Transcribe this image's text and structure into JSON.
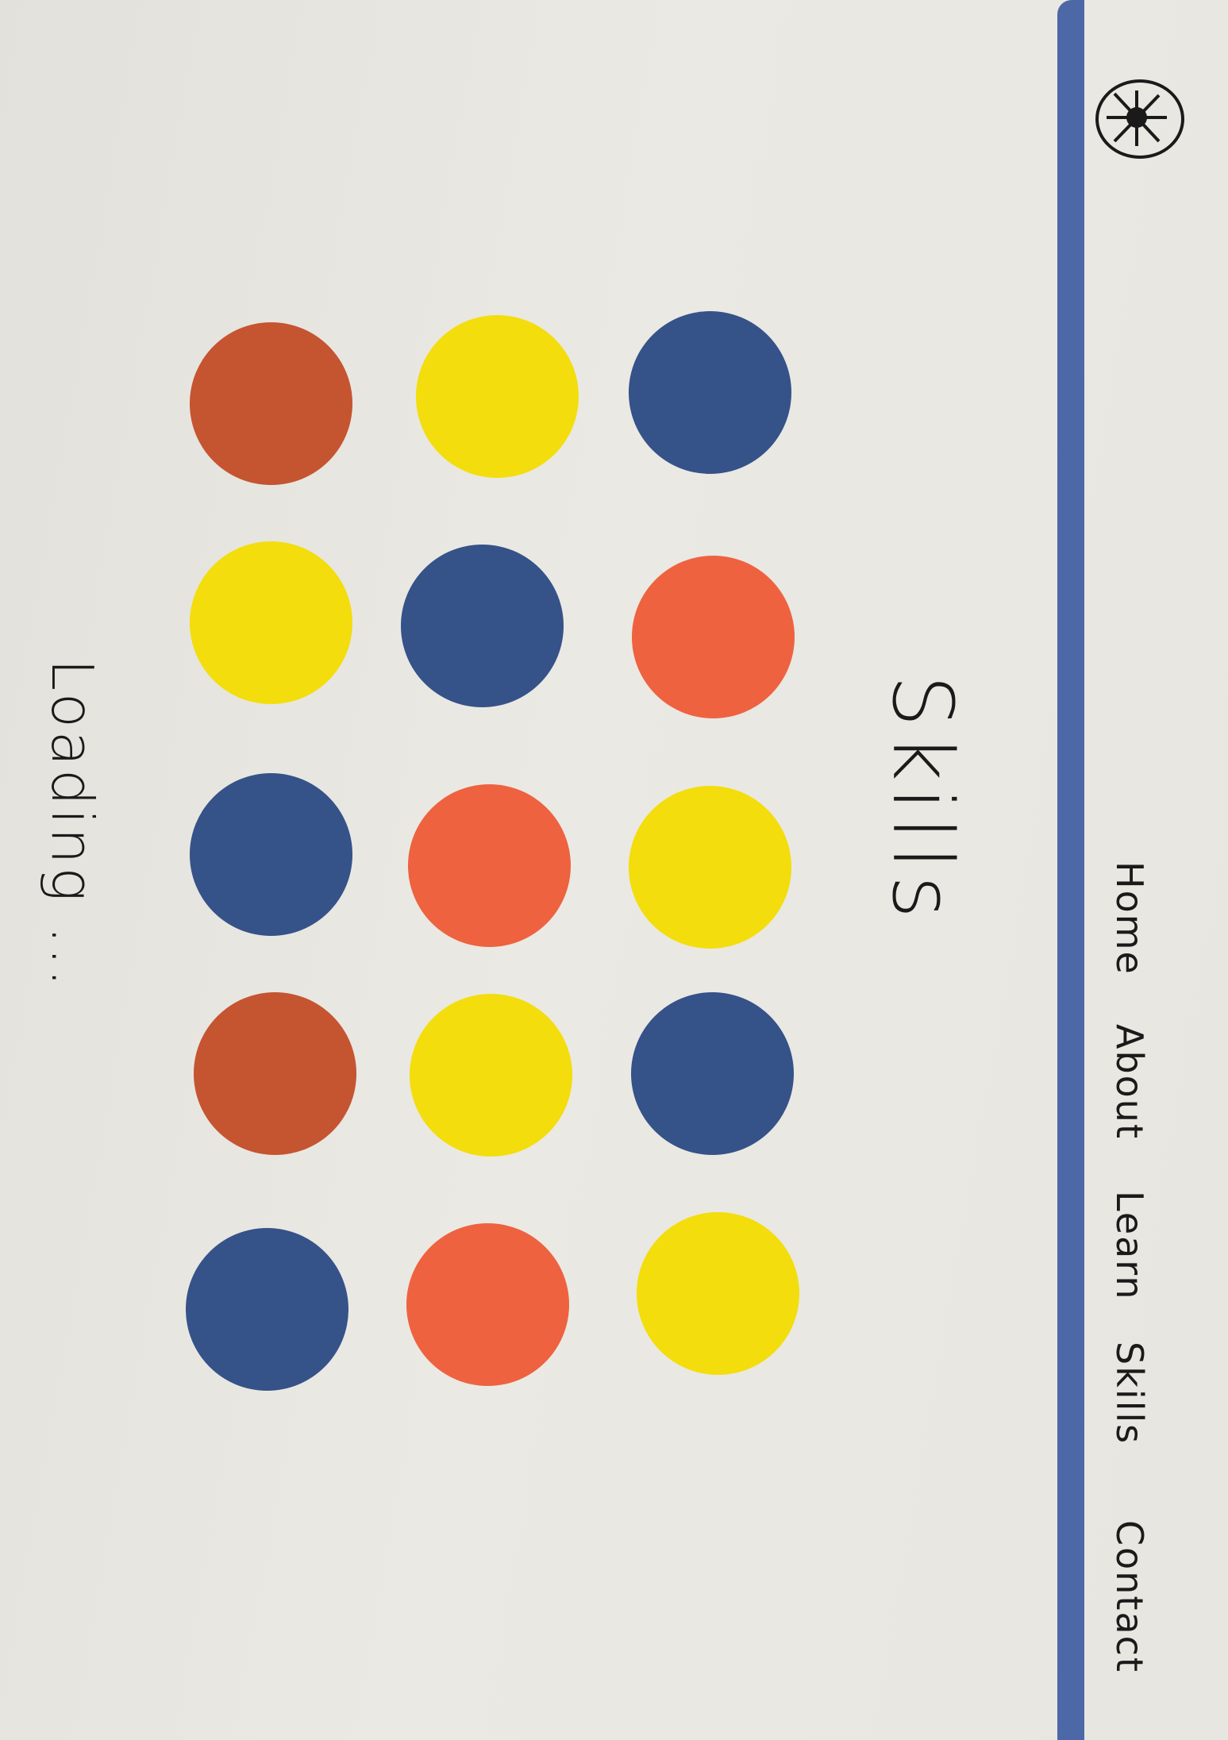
{
  "nav": {
    "items": [
      {
        "label": "Home"
      },
      {
        "label": "About"
      },
      {
        "label": "Learn"
      },
      {
        "label": "Skills"
      },
      {
        "label": "Contact"
      }
    ]
  },
  "page_title": "Skills",
  "loading_text": "Loading ...",
  "colors": {
    "rule": "#4d68a6",
    "navy": "#355289",
    "yellow": "#f3dd0c",
    "orange": "#ee6240",
    "rust": "#c55431"
  },
  "skill_dots": [
    {
      "color": "rust"
    },
    {
      "color": "yellow"
    },
    {
      "color": "navy"
    },
    {
      "color": "yellow"
    },
    {
      "color": "navy"
    },
    {
      "color": "orange"
    },
    {
      "color": "navy"
    },
    {
      "color": "orange"
    },
    {
      "color": "yellow"
    },
    {
      "color": "rust"
    },
    {
      "color": "yellow"
    },
    {
      "color": "navy"
    },
    {
      "color": "navy"
    },
    {
      "color": "orange"
    },
    {
      "color": "yellow"
    }
  ]
}
